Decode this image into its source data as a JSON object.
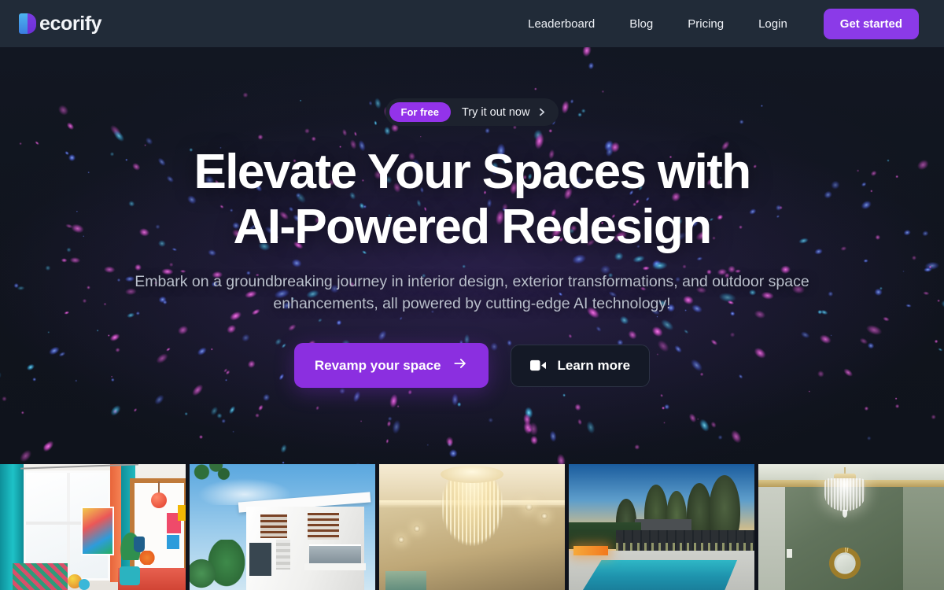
{
  "brand": {
    "name": "ecorify",
    "logo_letter": "D",
    "logo_color_left": "#4db4f0",
    "logo_color_right": "#7a3ce0"
  },
  "theme": {
    "header_bg": "#212b38",
    "hero_bg": "#121722",
    "accent_purple": "#8b3ae8",
    "badge_purple": "#9333ea",
    "text_primary": "#ffffff",
    "text_muted": "#b9bfcb"
  },
  "header": {
    "nav": [
      {
        "label": "Leaderboard",
        "name": "nav-link-leaderboard"
      },
      {
        "label": "Blog",
        "name": "nav-link-blog"
      },
      {
        "label": "Pricing",
        "name": "nav-link-pricing"
      },
      {
        "label": "Login",
        "name": "nav-link-login"
      }
    ],
    "cta_label": "Get started"
  },
  "hero": {
    "pill": {
      "badge": "For free",
      "text": "Try it out now",
      "chevron_icon": "chevron-right-icon"
    },
    "headline_line1": "Elevate Your Spaces with",
    "headline_line2": "AI-Powered Redesign",
    "subtitle_line1": "Embark on a groundbreaking journey in interior design, exterior transformations, and outdoor",
    "subtitle_line2": "space enhancements, all powered by cutting-edge AI technology!",
    "primary_cta": {
      "label": "Revamp your space",
      "icon": "arrow-right-icon"
    },
    "secondary_cta": {
      "label": "Learn more",
      "icon": "video-camera-icon"
    }
  },
  "gallery": {
    "items": [
      {
        "name": "gallery-tile-colorful-living-room",
        "alt": "Colorful eclectic living room with teal curtains and vibrant artwork"
      },
      {
        "name": "gallery-tile-modern-house-exterior",
        "alt": "Modern white flat-roof house exterior against blue sky"
      },
      {
        "name": "gallery-tile-crystal-chandelier-ceiling",
        "alt": "Luxury crystal chandelier with cove-lit beige ceiling"
      },
      {
        "name": "gallery-tile-backyard-pool",
        "alt": "Backyard swimming pool at dusk with trees and fire feature"
      },
      {
        "name": "gallery-tile-green-room-chandelier",
        "alt": "Sage green room with crystal chandelier and gold sunburst mirror"
      }
    ]
  }
}
